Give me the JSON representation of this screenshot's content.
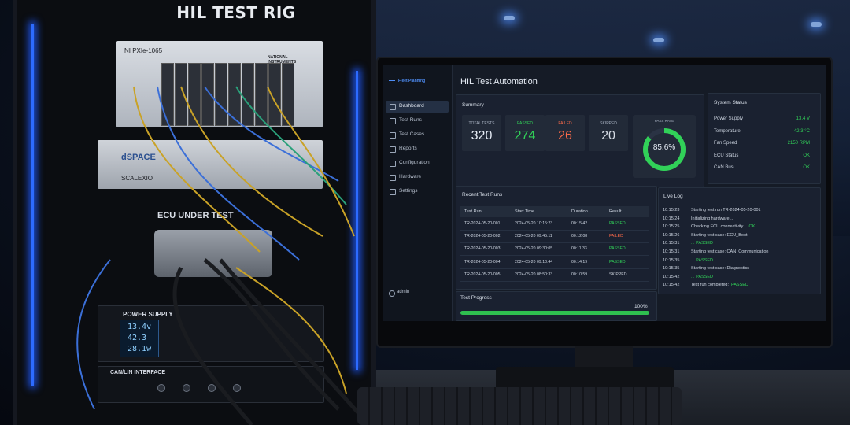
{
  "rack": {
    "title": "HIL TEST RIG",
    "ni_label": "NI PXIe-1065",
    "ni_brand": "NATIONAL INSTRUMENTS",
    "dspace_logo": "dSPACE",
    "scalexio": "SCALEXIO",
    "ecu_title": "ECU UNDER TEST",
    "psu_title": "POWER SUPPLY",
    "psu_values": [
      "13.4v",
      "42.3",
      "28.1w"
    ],
    "can_title": "CAN/LIN INTERFACE"
  },
  "app": {
    "brand": "Fleet Planning",
    "title": "HIL Test Automation",
    "nav": [
      {
        "label": "Dashboard",
        "icon": "dashboard-icon",
        "active": true
      },
      {
        "label": "Test Runs",
        "icon": "test-runs-icon"
      },
      {
        "label": "Test Cases",
        "icon": "test-cases-icon"
      },
      {
        "label": "Reports",
        "icon": "reports-icon"
      },
      {
        "label": "Configuration",
        "icon": "configuration-icon"
      },
      {
        "label": "Hardware",
        "icon": "hardware-icon"
      },
      {
        "label": "Settings",
        "icon": "settings-icon"
      }
    ],
    "user": "admin"
  },
  "summary": {
    "title": "Summary",
    "total": {
      "label": "TOTAL TESTS",
      "value": "320"
    },
    "passed": {
      "label": "PASSED",
      "value": "274"
    },
    "failed": {
      "label": "FAILED",
      "value": "26"
    },
    "skipped": {
      "label": "SKIPPED",
      "value": "20"
    },
    "pass_rate": {
      "label": "PASS RATE",
      "value": "85.6%",
      "fraction": 0.856
    }
  },
  "system_status": {
    "title": "System Status",
    "rows": [
      {
        "key": "Power Supply",
        "value": "13.4 V"
      },
      {
        "key": "Temperature",
        "value": "42.3 °C"
      },
      {
        "key": "Fan Speed",
        "value": "2150 RPM"
      },
      {
        "key": "ECU Status",
        "value": "OK"
      },
      {
        "key": "CAN Bus",
        "value": "OK"
      }
    ]
  },
  "recent_runs": {
    "title": "Recent Test Runs",
    "headers": [
      "Test Run",
      "Start Time",
      "Duration",
      "Result"
    ],
    "rows": [
      [
        "TR-2024-05-20-001",
        "2024-05-20 10:15:23",
        "00:15:42",
        "PASSED"
      ],
      [
        "TR-2024-05-20-002",
        "2024-05-20 09:45:11",
        "00:12:08",
        "FAILED"
      ],
      [
        "TR-2024-05-20-003",
        "2024-05-20 09:30:05",
        "00:11:33",
        "PASSED"
      ],
      [
        "TR-2024-05-20-004",
        "2024-05-20 09:10:44",
        "00:14:19",
        "PASSED"
      ],
      [
        "TR-2024-05-20-005",
        "2024-05-20 08:50:33",
        "00:10:59",
        "SKIPPED"
      ]
    ]
  },
  "live_log": {
    "title": "Live Log",
    "entries": [
      {
        "time": "10:15:23",
        "msg": "Starting test run TR-2024-05-20-001"
      },
      {
        "time": "10:15:24",
        "msg": "Initializing hardware..."
      },
      {
        "time": "10:15:25",
        "msg": "Checking ECU connectivity...",
        "tag": "OK"
      },
      {
        "time": "10:15:26",
        "msg": "Starting test case: ECU_Boot"
      },
      {
        "time": "10:15:31",
        "msg": "",
        "tag": "... PASSED"
      },
      {
        "time": "10:15:31",
        "msg": "Starting test case: CAN_Communication"
      },
      {
        "time": "10:15:35",
        "msg": "",
        "tag": "... PASSED"
      },
      {
        "time": "10:15:35",
        "msg": "Starting test case: Diagnostics"
      },
      {
        "time": "10:15:42",
        "msg": "",
        "tag": "... PASSED"
      },
      {
        "time": "10:15:42",
        "msg": "Test run completed:",
        "tag": "PASSED"
      }
    ]
  },
  "progress": {
    "title": "Test Progress",
    "label": "100%",
    "fraction": 1.0
  },
  "colors": {
    "pass": "#31d158",
    "fail": "#ff6b4a",
    "skip": "#c9cfd8",
    "accent": "#4e8df5"
  }
}
